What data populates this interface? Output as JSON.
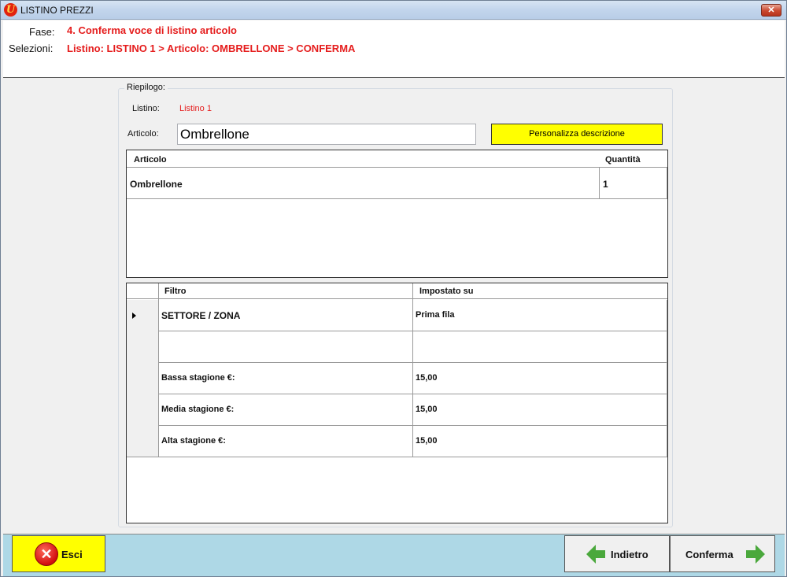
{
  "window": {
    "title": "LISTINO PREZZI",
    "close_glyph": "✕"
  },
  "header": {
    "fase_label": "Fase:",
    "fase_value": "4. Conferma voce di listino articolo",
    "selezioni_label": "Selezioni:",
    "selezioni_value": "Listino: LISTINO 1 > Articolo: OMBRELLONE > CONFERMA"
  },
  "summary": {
    "caption": "Riepilogo:",
    "listino_label": "Listino:",
    "listino_value": "Listino 1",
    "articolo_label": "Articolo:",
    "articolo_value": "Ombrellone",
    "personalizza_label": "Personalizza descrizione"
  },
  "article_grid": {
    "columns": [
      "Articolo",
      "Quantità"
    ],
    "rows": [
      {
        "articolo": "Ombrellone",
        "quantita": "1"
      }
    ]
  },
  "filter_grid": {
    "columns": [
      "Filtro",
      "Impostato su"
    ],
    "rows": [
      {
        "filtro": "SETTORE / ZONA",
        "valore": "Prima fila",
        "current": true
      },
      {
        "filtro": "",
        "valore": ""
      },
      {
        "filtro": "Bassa stagione €:",
        "valore": "15,00"
      },
      {
        "filtro": "Media stagione €:",
        "valore": "15,00"
      },
      {
        "filtro": "Alta stagione €:",
        "valore": "15,00"
      }
    ]
  },
  "bottom": {
    "exit_label": "Esci",
    "back_label": "Indietro",
    "confirm_label": "Conferma"
  },
  "colors": {
    "accent_red": "#e51c1c",
    "button_yellow": "#ffff00",
    "bottom_bar": "#aed8e6",
    "arrow_green": "#4aa83c"
  },
  "icons": [
    "app-logo-icon",
    "close-icon",
    "row-pointer-icon",
    "exit-icon",
    "arrow-left-icon",
    "arrow-right-icon"
  ]
}
